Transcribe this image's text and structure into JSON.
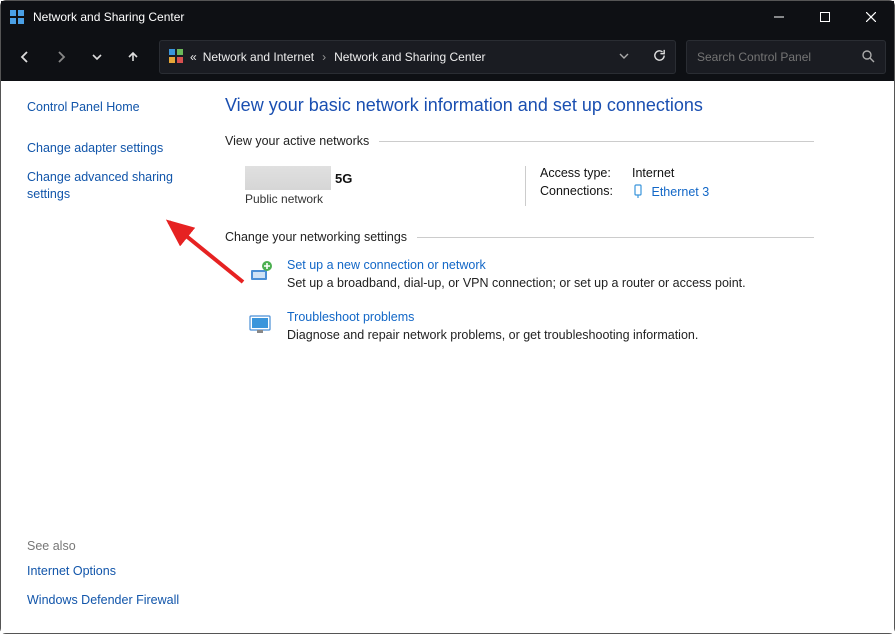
{
  "window": {
    "title": "Network and Sharing Center"
  },
  "address": {
    "prefix": "«",
    "crumb_parent": "Network and Internet",
    "crumb_current": "Network and Sharing Center"
  },
  "search": {
    "placeholder": "Search Control Panel"
  },
  "sidebar": {
    "home": "Control Panel Home",
    "adapter": "Change adapter settings",
    "advanced": "Change advanced sharing settings",
    "see_also_label": "See also",
    "internet_options": "Internet Options",
    "firewall": "Windows Defender Firewall"
  },
  "main": {
    "title": "View your basic network information and set up connections",
    "section_active": "View your active networks",
    "network": {
      "name_suffix": "5G",
      "type": "Public network",
      "access_label": "Access type:",
      "access_value": "Internet",
      "connections_label": "Connections:",
      "connections_value": "Ethernet 3"
    },
    "section_change": "Change your networking settings",
    "setup": {
      "link": "Set up a new connection or network",
      "desc": "Set up a broadband, dial-up, or VPN connection; or set up a router or access point."
    },
    "troubleshoot": {
      "link": "Troubleshoot problems",
      "desc": "Diagnose and repair network problems, or get troubleshooting information."
    }
  }
}
